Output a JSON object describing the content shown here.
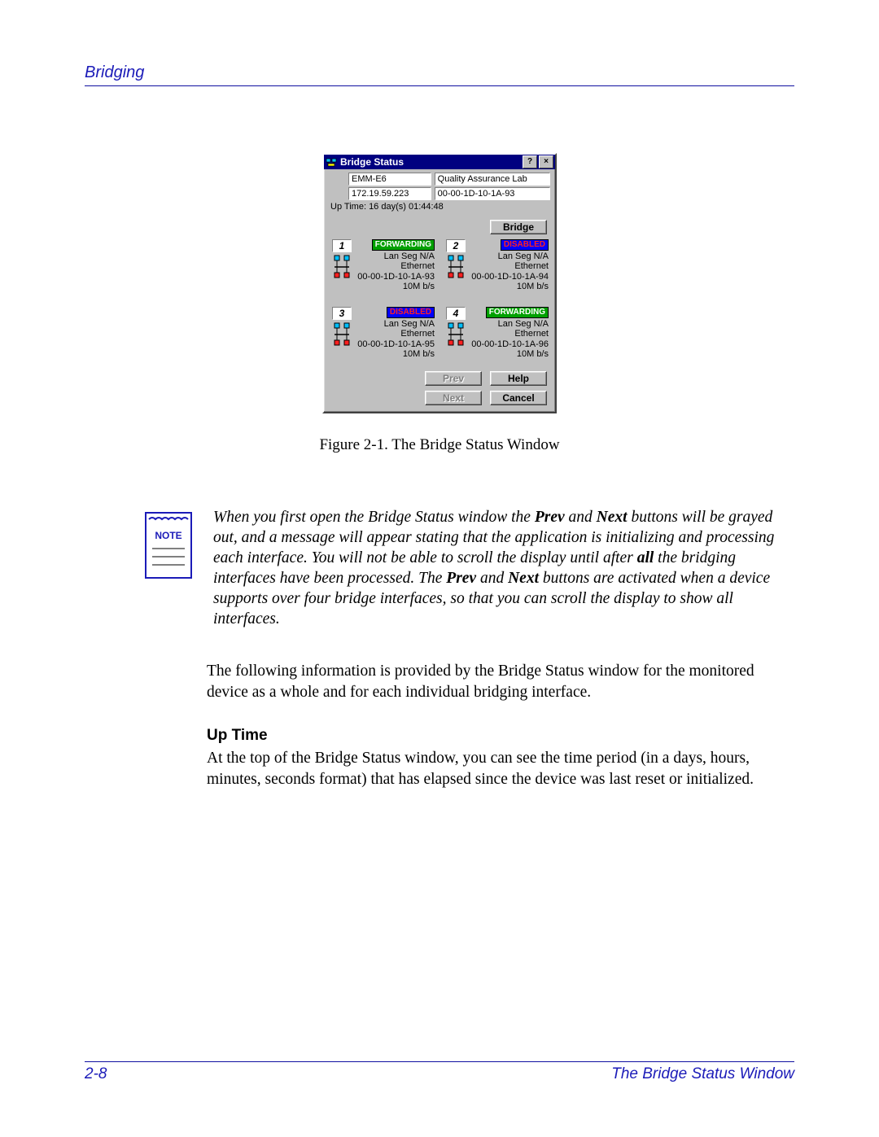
{
  "header": {
    "section_title": "Bridging"
  },
  "dialog": {
    "window_title": "Bridge Status",
    "help_btn_glyph": "?",
    "close_btn_glyph": "×",
    "device_name": "EMM-E6",
    "location": "Quality Assurance Lab",
    "ip": "172.19.59.223",
    "mac": "00-00-1D-10-1A-93",
    "uptime": "Up Time: 16 day(s) 01:44:48",
    "bridge_btn": "Bridge",
    "ports": [
      {
        "num": "1",
        "status": "FORWARDING",
        "lanseg": "Lan Seg N/A",
        "type": "Ethernet",
        "mac": "00-00-1D-10-1A-93",
        "speed": "10M b/s"
      },
      {
        "num": "2",
        "status": "DISABLED",
        "lanseg": "Lan Seg N/A",
        "type": "Ethernet",
        "mac": "00-00-1D-10-1A-94",
        "speed": "10M b/s"
      },
      {
        "num": "3",
        "status": "DISABLED",
        "lanseg": "Lan Seg N/A",
        "type": "Ethernet",
        "mac": "00-00-1D-10-1A-95",
        "speed": "10M b/s"
      },
      {
        "num": "4",
        "status": "FORWARDING",
        "lanseg": "Lan Seg N/A",
        "type": "Ethernet",
        "mac": "00-00-1D-10-1A-96",
        "speed": "10M b/s"
      }
    ],
    "buttons": {
      "prev": "Prev",
      "next": "Next",
      "help": "Help",
      "cancel": "Cancel"
    }
  },
  "figure_caption": "Figure 2-1. The Bridge Status Window",
  "note": {
    "label": "NOTE",
    "p1a": "When you first open the Bridge Status window the ",
    "p1b": "Prev",
    "p1c": " and ",
    "p1d": "Next",
    "p1e": " buttons will be grayed out, and a message will appear stating that the application is initializing and processing each interface. You will not be able to scroll the display until after ",
    "p1f": "all",
    "p1g": " the bridging interfaces have been processed. The ",
    "p1h": "Prev",
    "p1i": " and ",
    "p1j": "Next",
    "p1k": " buttons are activated when a device supports over four bridge interfaces, so that you can scroll the display to show all interfaces."
  },
  "body": {
    "para1": "The following information is provided by the Bridge Status window for the monitored device as a whole and for each individual bridging interface.",
    "heading": "Up Time",
    "para2": "At the top of the Bridge Status window, you can see the time period (in a days, hours, minutes, seconds format) that has elapsed since the device was last reset or initialized."
  },
  "footer": {
    "page_num": "2-8",
    "title": "The Bridge Status Window"
  }
}
